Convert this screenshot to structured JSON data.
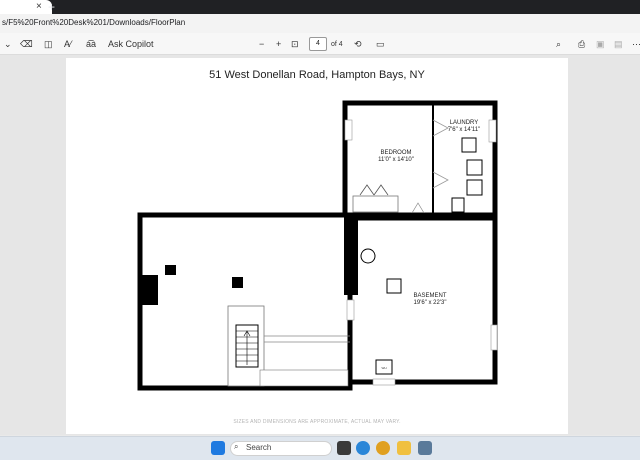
{
  "browser": {
    "url": "s/F5%20Front%20Desk%201/Downloads/FloorPlan",
    "new_tab": "+",
    "tab_close": "×"
  },
  "toolbar": {
    "ai_label": "Ask Copilot",
    "page_number": "4",
    "page_total": "of 4",
    "zoom_out": "−",
    "zoom_in": "+"
  },
  "floorplan": {
    "title": "51 West Donellan Road, Hampton Bays, NY",
    "rooms": [
      {
        "name": "BEDROOM",
        "size": "11'0\" x 14'10\""
      },
      {
        "name": "LAUNDRY",
        "size": "7'6\" x 14'11\""
      },
      {
        "name": "BASEMENT",
        "size": "19'6\" x 22'3\""
      }
    ],
    "disclaimer": "SIZES AND DIMENSIONS ARE APPROXIMATE, ACTUAL MAY VARY."
  },
  "taskbar": {
    "search_placeholder": "Search"
  }
}
